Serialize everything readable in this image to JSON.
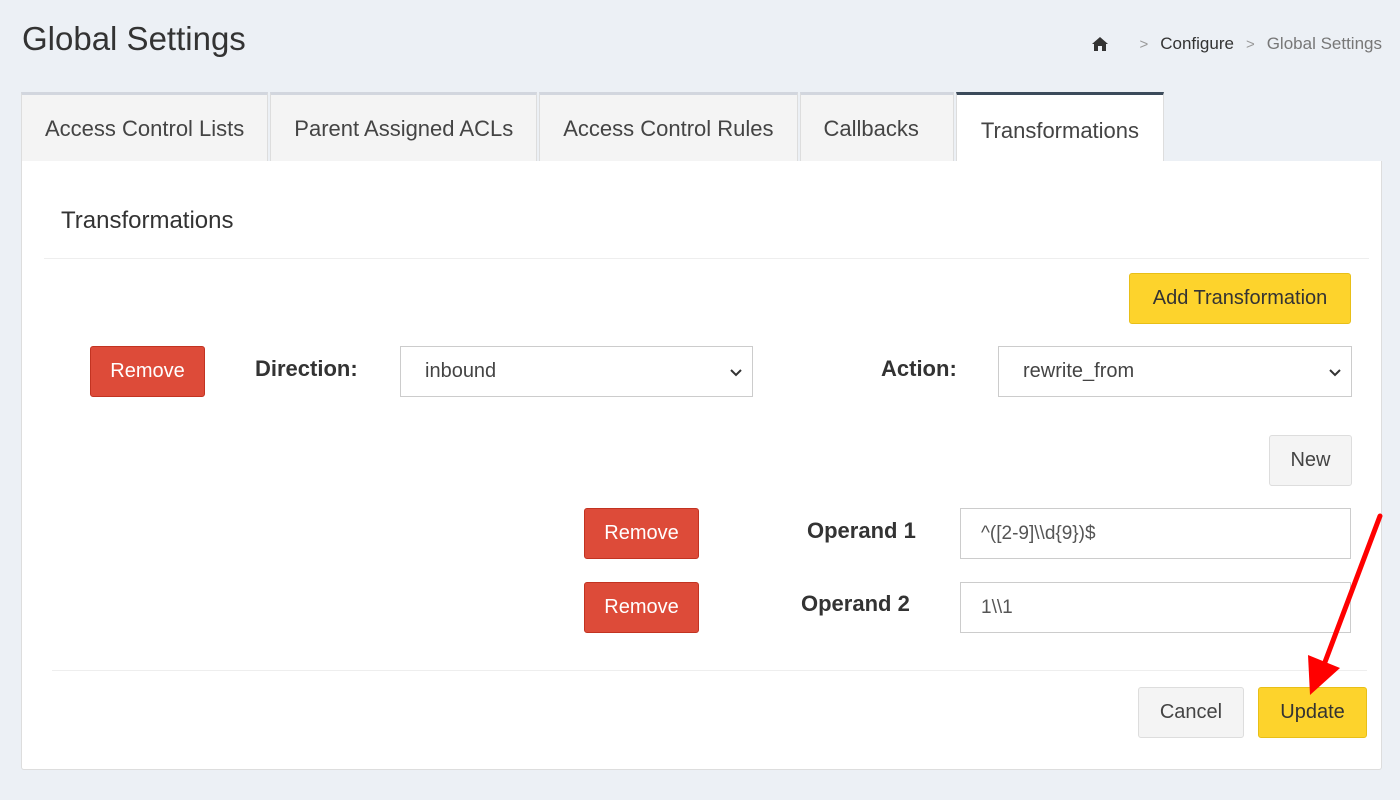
{
  "header": {
    "title": "Global Settings",
    "breadcrumb": {
      "sep1": ">",
      "configure": "Configure",
      "sep2": ">",
      "current": "Global Settings"
    }
  },
  "tabs": [
    {
      "label": "Access Control Lists"
    },
    {
      "label": "Parent Assigned ACLs"
    },
    {
      "label": "Access Control Rules"
    },
    {
      "label": "Callbacks"
    },
    {
      "label": "Transformations"
    }
  ],
  "panel": {
    "title": "Transformations",
    "add_label": "Add Transformation",
    "remove_label": "Remove",
    "direction_label": "Direction:",
    "direction_value": "inbound",
    "action_label": "Action:",
    "action_value": "rewrite_from",
    "new_label": "New",
    "operands": [
      {
        "label": "Operand 1",
        "value": "^([2-9]\\\\d{9})$",
        "remove_label": "Remove"
      },
      {
        "label": "Operand 2",
        "value": "1\\\\1",
        "remove_label": "Remove"
      }
    ],
    "cancel_label": "Cancel",
    "update_label": "Update"
  },
  "colors": {
    "accent_yellow": "#fdd32c",
    "danger_red": "#dd4b39",
    "annotation_arrow": "#ff0000"
  }
}
